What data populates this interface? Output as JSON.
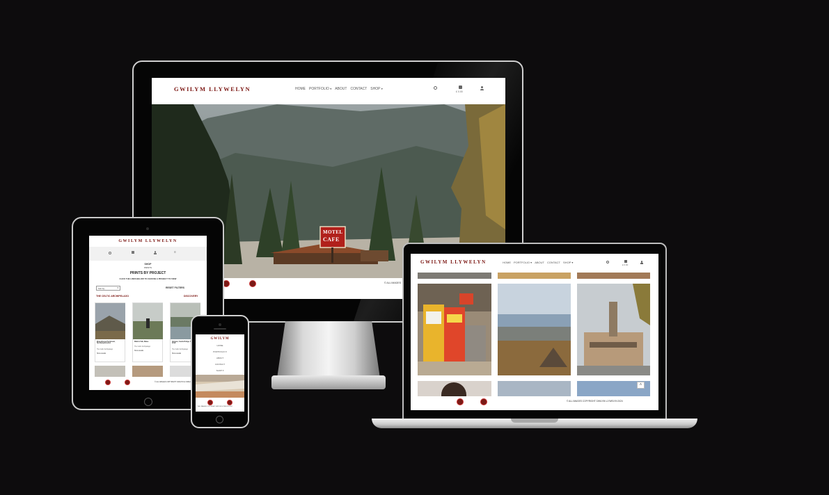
{
  "brand": {
    "name": "GWILYM LLYWELYN",
    "short_name": "GWILYM",
    "color": "#7a1410"
  },
  "desktop": {
    "nav": [
      "HOME",
      "PORTFOLIO",
      "ABOUT",
      "CONTACT",
      "SHOP"
    ],
    "cart_total": "£ 0.00",
    "footer_copyright": "ALL IMAGES"
  },
  "laptop": {
    "nav": [
      "HOME",
      "PORTFOLIO",
      "ABOUT",
      "CONTACT",
      "SHOP"
    ],
    "cart_total": "£ 0.00",
    "footer_copyright": "ALL IMAGES COPYRIGHT GWILYM LLYWELYN 2024",
    "back_to_top_icon": "chevron-up-icon"
  },
  "tablet": {
    "breadcrumb_1": "SHOP",
    "breadcrumb_2": "PRINTS",
    "heading": "PRINTS BY PROJECT",
    "subheading": "CLICK THE LINKS BELOW TO CHOOSE A PROJECT TO VIEW",
    "sort_placeholder": "Sort by...",
    "reset_filters": "RESET FILTERS",
    "project_left": "THE CELTIC ARCHIPELAGO",
    "project_right": "DISCOVERY",
    "products": [
      {
        "title": "Elmesthorpe Peripheral, Northamptonshire",
        "meta": "The Celtic Archipelago",
        "link": "Show details"
      },
      {
        "title": "Walk & Talk, Wales",
        "meta": "The Celtic Archipelago",
        "link": "Show details"
      },
      {
        "title": "Hotspur, Castle Bridge, Scarth Ness, 2019",
        "meta": "The Celtic Archipelago",
        "link": "Show details"
      }
    ],
    "footer_copyright": "ALL IMAGES COPYRIGHT GWILYM LLYWELYN 2024"
  },
  "phone": {
    "menu": [
      "HOME",
      "PORTFOLIO",
      "ABOUT",
      "CONTACT",
      "SHOP"
    ],
    "footer_copyright": "ALL IMAGES COPYRIGHT GWILYM LLYWELYN 2024"
  },
  "hero": {
    "sign_line1": "MOTEL",
    "sign_line2": "CAFE"
  }
}
